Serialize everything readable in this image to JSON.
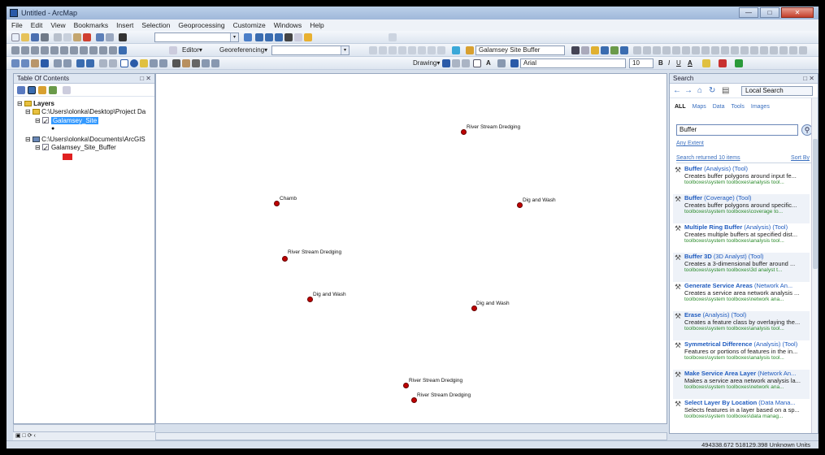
{
  "window": {
    "title": "Untitled - ArcMap"
  },
  "menu": [
    "File",
    "Edit",
    "View",
    "Bookmarks",
    "Insert",
    "Selection",
    "Geoprocessing",
    "Customize",
    "Windows",
    "Help"
  ],
  "toolbar": {
    "editor_label": "Editor▾",
    "georef_label": "Georeferencing▾",
    "layer_combo": "Galamsey Site Buffer",
    "drawing_label": "Drawing▾",
    "font_combo": "Arial",
    "size_combo": "10"
  },
  "toc": {
    "title": "Table Of Contents",
    "layers_label": "Layers",
    "folder1": "C:\\Users\\olonka\\Desktop\\Project Da",
    "layer1": "Galamsey_Site",
    "folder2": "C:\\Users\\olonka\\Documents\\ArcGIS",
    "layer2": "Galamsey_Site_Buffer"
  },
  "map": {
    "points": [
      {
        "label": "River Stream Dredging"
      },
      {
        "label": "Chamb"
      },
      {
        "label": "Dig and Wash"
      },
      {
        "label": "River Stream Dredging"
      },
      {
        "label": "Dig and Wash"
      },
      {
        "label": "Dig and Wash"
      },
      {
        "label": "River Stream Dredging"
      },
      {
        "label": "River Stream Dredging"
      }
    ]
  },
  "search": {
    "title": "Search",
    "scope": "Local Search",
    "filters": [
      "ALL",
      "Maps",
      "Data",
      "Tools",
      "Images"
    ],
    "query": "Buffer",
    "options_link": "Any Extent",
    "results_count": "Search returned 10 items",
    "sort_label": "Sort By",
    "results": [
      {
        "title_bold": "Buffer",
        "title_rest": " (Analysis) (Tool)",
        "desc": "Creates buffer polygons around input fe...",
        "path": "toolboxes\\system toolboxes\\analysis tool..."
      },
      {
        "title_bold": "Buffer",
        "title_rest": " (Coverage) (Tool)",
        "desc": "Creates buffer polygons around specific...",
        "path": "toolboxes\\system toolboxes\\coverage to..."
      },
      {
        "title_bold": "Multiple Ring Buffer",
        "title_rest": " (Analysis) (Tool)",
        "desc": "Creates multiple buffers at specified dist...",
        "path": "toolboxes\\system toolboxes\\analysis tool..."
      },
      {
        "title_bold": "Buffer 3D",
        "title_rest": " (3D Analyst) (Tool)",
        "desc": "Creates a 3-dimensional buffer around ...",
        "path": "toolboxes\\system toolboxes\\3d analyst t..."
      },
      {
        "title_bold": "Generate Service Areas",
        "title_rest": " (Network An...",
        "desc": "Creates a service area network analysis ...",
        "path": "toolboxes\\system toolboxes\\network ana..."
      },
      {
        "title_bold": "Erase",
        "title_rest": " (Analysis) (Tool)",
        "desc": "Creates a feature class by overlaying the...",
        "path": "toolboxes\\system toolboxes\\analysis tool..."
      },
      {
        "title_bold": "Symmetrical Difference",
        "title_rest": " (Analysis) (Tool)",
        "desc": "Features or portions of features in the in...",
        "path": "toolboxes\\system toolboxes\\analysis tool..."
      },
      {
        "title_bold": "Make Service Area Layer",
        "title_rest": " (Network An...",
        "desc": "Makes a service area network analysis la...",
        "path": "toolboxes\\system toolboxes\\network ana..."
      },
      {
        "title_bold": "Select Layer By Location",
        "title_rest": " (Data Mana...",
        "desc": "Selects features in a layer based on a sp...",
        "path": "toolboxes\\system toolboxes\\data manag..."
      }
    ]
  },
  "status": {
    "coords": "494338.672  518129.398 Unknown Units"
  }
}
